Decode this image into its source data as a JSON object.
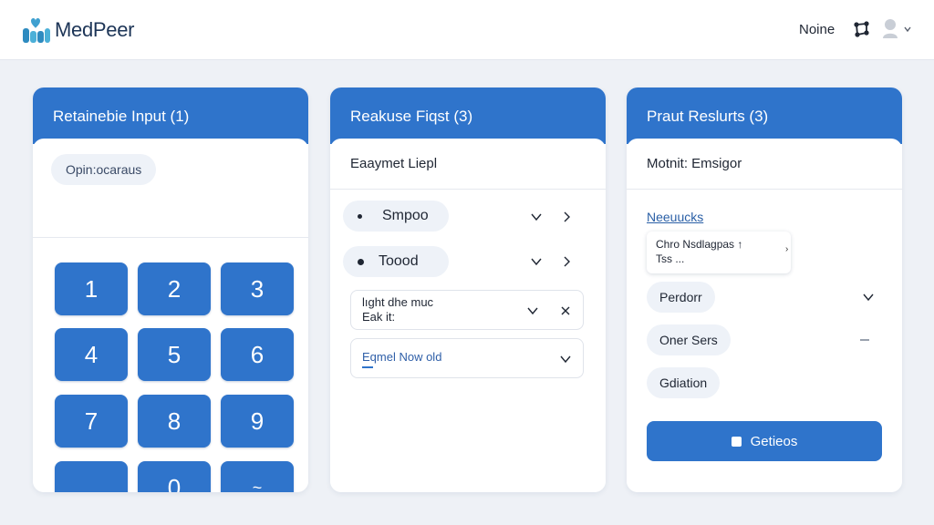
{
  "app": {
    "name": "MedPeer"
  },
  "header": {
    "user_name": "Noine",
    "icons": {
      "network": "nodes-icon",
      "avatar": "user-avatar-icon",
      "menu": "chevron-down-icon"
    }
  },
  "colors": {
    "accent": "#2f74cb",
    "background": "#eef1f6",
    "panel": "#ffffff",
    "pill": "#eef2f8"
  },
  "panel_input": {
    "title": "Retainebie Input (1)",
    "mode_label": "Opin:ocaraus",
    "keys": [
      "1",
      "2",
      "3",
      "4",
      "5",
      "6",
      "7",
      "8",
      "9",
      "",
      "0",
      "~"
    ]
  },
  "panel_review": {
    "title": "Reakuse Fiqst (3)",
    "subheading": "Eaaymet Liepl",
    "items": [
      "Smpoo",
      "Toood"
    ],
    "note": {
      "line1": "lıght dhe muc",
      "line2": "Eak it:"
    },
    "field_value": "Eqmel Now old"
  },
  "panel_results": {
    "title": "Praut Reslurts (3)",
    "subheading": "Motnit: Emsigor",
    "link": "Neeuucks",
    "popup": {
      "line1": "Chro Nsdlagpas ↑",
      "line2": "Tss ..."
    },
    "options": [
      "Perdorr",
      "Oner Sers",
      "Gdiation"
    ],
    "action_label": "Getieos"
  }
}
